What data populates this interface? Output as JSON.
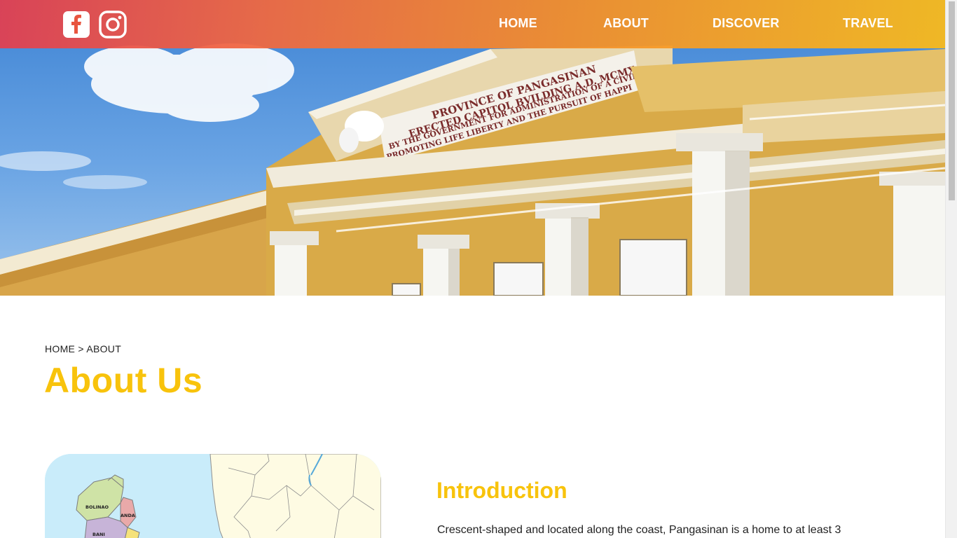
{
  "nav": {
    "items": [
      "HOME",
      "ABOUT",
      "DISCOVER",
      "TRAVEL"
    ],
    "social_icons": [
      "facebook-icon",
      "instagram-icon"
    ]
  },
  "hero": {
    "inscription": [
      "PROVINCE OF PANGASINAN",
      "ERECTED CAPITOL BVILDING A.D. MCMX",
      "BY THE GOVERNMENT FOR ADMINISTRATION OF A CIVIL",
      "PROMOTING LIFE LIBERTY AND THE PURSUIT OF HAPPI"
    ]
  },
  "breadcrumb": {
    "home": "HOME",
    "separator": ">",
    "current": "ABOUT"
  },
  "page": {
    "title": "About Us"
  },
  "map": {
    "labels": [
      "BOLINAO",
      "ANDA",
      "BANI"
    ]
  },
  "intro": {
    "title": "Introduction",
    "text": "Crescent-shaped and located along the coast, Pangasinan is a home to at least 3"
  },
  "colors": {
    "accent": "#f8c30c",
    "nav_gradient": [
      "#e43e4e",
      "#f8ba1c"
    ],
    "building": "#d9aa48"
  }
}
